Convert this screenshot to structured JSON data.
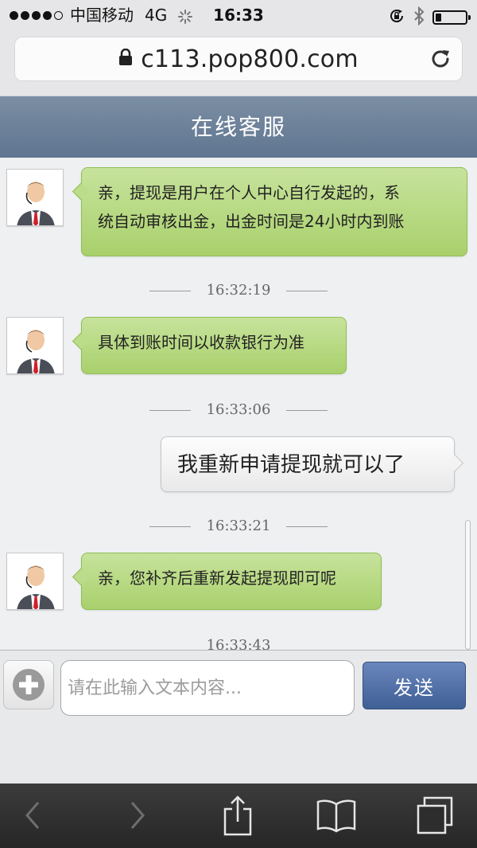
{
  "status_bar": {
    "carrier": "中国移动",
    "network": "4G",
    "time": "16:33",
    "signal_bars_filled": 4,
    "signal_bars_total": 5,
    "battery_level": 0.2
  },
  "browser": {
    "url": "c113.pop800.com",
    "icons": {
      "lock": "lock-icon",
      "reload": "reload-icon"
    }
  },
  "chat": {
    "title": "在线客服",
    "messages": [
      {
        "from": "agent",
        "lines": [
          "亲，提现是用户在个人中心自行发起的，系",
          "统自动审核出金，出金时间是24小时内到账"
        ]
      },
      {
        "time": "16:32:19"
      },
      {
        "from": "agent",
        "text": "具体到账时间以收款银行为准"
      },
      {
        "time": "16:33:06"
      },
      {
        "from": "user",
        "text": "我重新申请提现就可以了"
      },
      {
        "time": "16:33:21"
      },
      {
        "from": "agent",
        "text": "亲，您补齐后重新发起提现即可呢"
      },
      {
        "time": "16:33:43"
      }
    ]
  },
  "composer": {
    "placeholder": "请在此输入文本内容...",
    "send_label": "发送",
    "add_icon": "plus-circle-icon"
  },
  "toolbar": {
    "items": [
      "back-icon",
      "forward-icon",
      "share-icon",
      "bookmarks-icon",
      "tabs-icon"
    ]
  },
  "colors": {
    "header": "#6a7f98",
    "agent_bubble": "#b8da86",
    "send_button": "#4e6ea5"
  }
}
